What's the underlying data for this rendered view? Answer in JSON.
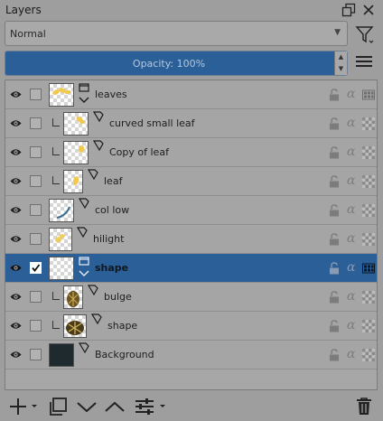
{
  "panel": {
    "title": "Layers",
    "float_icon": "float-icon",
    "close_icon": "close-icon"
  },
  "blending": {
    "mode": "Normal"
  },
  "opacity": {
    "label": "Opacity:  100%",
    "value": 100
  },
  "icons": {
    "filter": "filter-icon",
    "menu": "hamburger-menu-icon"
  },
  "colors": {
    "selection": "#2b5f98",
    "background_layer": "#1f2a2e"
  },
  "layers": [
    {
      "name": "leaves",
      "type": "group",
      "level": 0,
      "visible": true,
      "checked": false,
      "selected": false,
      "inherit_alpha": false,
      "collapsible": true
    },
    {
      "name": "curved small leaf",
      "type": "vector",
      "level": 1,
      "visible": true,
      "checked": false,
      "selected": false,
      "inherit_alpha": true,
      "collapsible": false
    },
    {
      "name": "Copy of leaf",
      "type": "vector",
      "level": 1,
      "visible": true,
      "checked": false,
      "selected": false,
      "inherit_alpha": true,
      "collapsible": false
    },
    {
      "name": "leaf",
      "type": "vector",
      "level": 1,
      "visible": true,
      "checked": false,
      "selected": false,
      "inherit_alpha": true,
      "collapsible": false
    },
    {
      "name": "col low",
      "type": "vector",
      "level": 0,
      "visible": true,
      "checked": false,
      "selected": false,
      "inherit_alpha": true,
      "collapsible": false
    },
    {
      "name": "hilight",
      "type": "vector",
      "level": 0,
      "visible": true,
      "checked": false,
      "selected": false,
      "inherit_alpha": true,
      "collapsible": false
    },
    {
      "name": "shape",
      "type": "group",
      "level": 0,
      "visible": true,
      "checked": true,
      "selected": true,
      "inherit_alpha": false,
      "collapsible": true
    },
    {
      "name": "bulge",
      "type": "vector",
      "level": 1,
      "visible": true,
      "checked": false,
      "selected": false,
      "inherit_alpha": true,
      "collapsible": false
    },
    {
      "name": "shape",
      "type": "vector",
      "level": 1,
      "visible": true,
      "checked": false,
      "selected": false,
      "inherit_alpha": true,
      "collapsible": false
    },
    {
      "name": "Background",
      "type": "vector",
      "level": 0,
      "visible": true,
      "checked": false,
      "selected": false,
      "inherit_alpha": true,
      "collapsible": false
    }
  ],
  "toolbar": {
    "add_icon": "add-layer-icon",
    "duplicate_icon": "duplicate-layer-icon",
    "move_down_icon": "move-down-icon",
    "move_up_icon": "move-up-icon",
    "properties_icon": "layer-properties-icon",
    "delete_icon": "trash-icon"
  }
}
